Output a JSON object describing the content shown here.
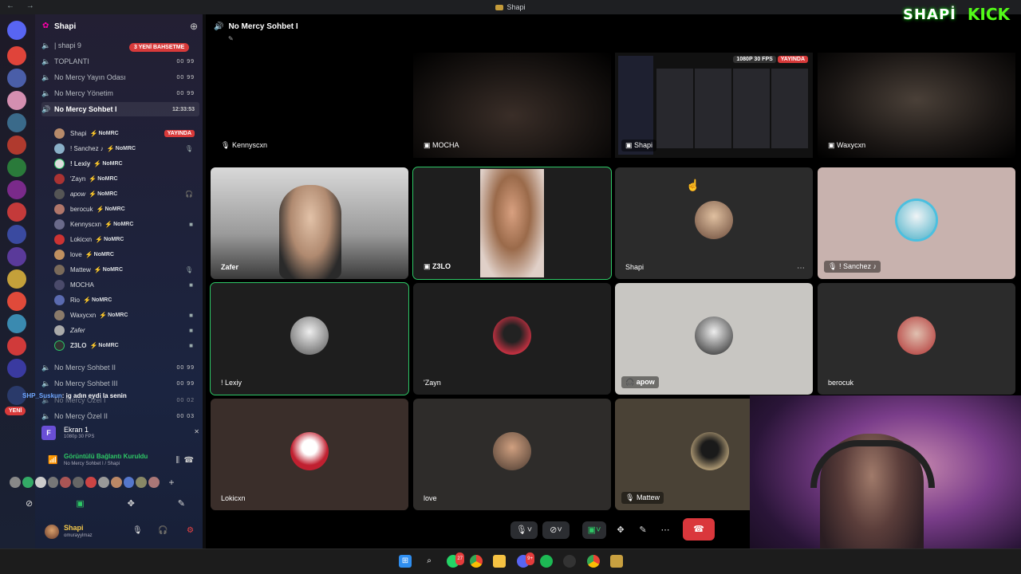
{
  "window": {
    "title": "Shapi"
  },
  "server": {
    "name": "Shapi"
  },
  "sidebar": {
    "pill_new": "3 YENİ BAHSETME",
    "channels": [
      {
        "label": "| shapi 9",
        "count": ""
      },
      {
        "label": "TOPLANTI",
        "count": "00 99"
      },
      {
        "label": "No Mercy Yayın Odası",
        "count": "00 99"
      },
      {
        "label": "No Mercy Yönetim",
        "count": "00 99"
      },
      {
        "label": "No Mercy Sohbet I",
        "count": "12:33:53"
      }
    ],
    "members": [
      {
        "name": "Shapi",
        "tag": "NoMRC",
        "status": "YAYINDA"
      },
      {
        "name": "! Sanchez ♪",
        "tag": "NoMRC"
      },
      {
        "name": "! Lexiy",
        "tag": "NoMRC"
      },
      {
        "name": "'Zayn",
        "tag": "NoMRC"
      },
      {
        "name": "apow",
        "tag": "NoMRC"
      },
      {
        "name": "berocuk",
        "tag": "NoMRC"
      },
      {
        "name": "Kennyscxn",
        "tag": "NoMRC"
      },
      {
        "name": "Lokicxn",
        "tag": "NoMRC"
      },
      {
        "name": "love",
        "tag": "NoMRC"
      },
      {
        "name": "Mattew",
        "tag": "NoMRC"
      },
      {
        "name": "MOCHA",
        "tag": ""
      },
      {
        "name": "Rio",
        "tag": "NoMRC"
      },
      {
        "name": "Waxycxn",
        "tag": "NoMRC"
      },
      {
        "name": "Zafer",
        "tag": ""
      },
      {
        "name": "Z3LO",
        "tag": "NoMRC"
      }
    ],
    "channels_after": [
      {
        "label": "No Mercy Sohbet II",
        "count": "00 99"
      },
      {
        "label": "No Mercy Sohbet III",
        "count": "00 99"
      },
      {
        "label": "No Mercy Özel I",
        "count": "00 02"
      },
      {
        "label": "No Mercy Özel II",
        "count": "00 03"
      }
    ],
    "chat_user": "SHP_Suskun",
    "chat_text": ": ig adın eydi la senin",
    "yeni": "YENİ",
    "screen_name": "Ekran 1",
    "screen_sub": "1080p 30 FPS",
    "voice_status": "Görüntülü Bağlantı Kuruldu",
    "voice_sub": "No Mercy Sohbet I / Shapi",
    "user_name": "Shapi",
    "user_handle": "omurayylmaz"
  },
  "main": {
    "channel_title": "No Mercy Sohbet I",
    "tiles": [
      {
        "name": "Kennyscxn"
      },
      {
        "name": "MOCHA"
      },
      {
        "name": "Shapi"
      },
      {
        "name": "Waxycxn"
      },
      {
        "name": "Zafer"
      },
      {
        "name": "Z3LO"
      },
      {
        "name": "Shapi"
      },
      {
        "name": "! Sanchez ♪"
      },
      {
        "name": "! Lexiy"
      },
      {
        "name": "'Zayn"
      },
      {
        "name": "apow"
      },
      {
        "name": "berocuk"
      },
      {
        "name": "Lokicxn"
      },
      {
        "name": "love"
      },
      {
        "name": "Mattew"
      }
    ],
    "stream_quality": "1080P 30 FPS",
    "stream_live": "YAYINDA"
  },
  "brand": {
    "shapi": "SHAPİ",
    "kick": "KICK"
  },
  "colors": {
    "accent_green": "#2ec866",
    "live_red": "#d83a3a",
    "hangup": "#da373c"
  }
}
